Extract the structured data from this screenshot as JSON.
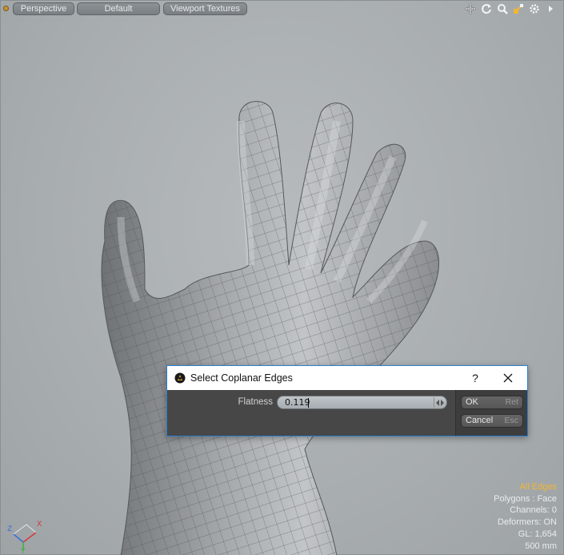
{
  "toolbar": {
    "view_mode": "Perspective",
    "shading": "Default",
    "texture_mode": "Viewport Textures",
    "icons": [
      "move-view-icon",
      "rotate-view-icon",
      "zoom-view-icon",
      "frame-view-icon",
      "viewport-settings-icon",
      "more-arrow-icon"
    ]
  },
  "dialog": {
    "title": "Select Coplanar Edges",
    "help": "?",
    "flatness_label": "Flatness",
    "flatness_value": "0.119",
    "ok_label": "OK",
    "ok_key": "Ret",
    "cancel_label": "Cancel",
    "cancel_key": "Esc"
  },
  "stats": {
    "selection_mode": "All Edges",
    "polygons": "Polygons : Face",
    "channels": "Channels: 0",
    "deformers": "Deformers: ON",
    "gl": "GL: 1,654",
    "scale": "500 mm"
  },
  "axis_labels": {
    "x": "X",
    "y": "Y",
    "z": "Z"
  },
  "colors": {
    "accent_orange": "#f2b632",
    "dialog_border": "#2d7fd1",
    "axis_x": "#d43a3a",
    "axis_y": "#3bb33b",
    "axis_z": "#3a6fd8"
  }
}
